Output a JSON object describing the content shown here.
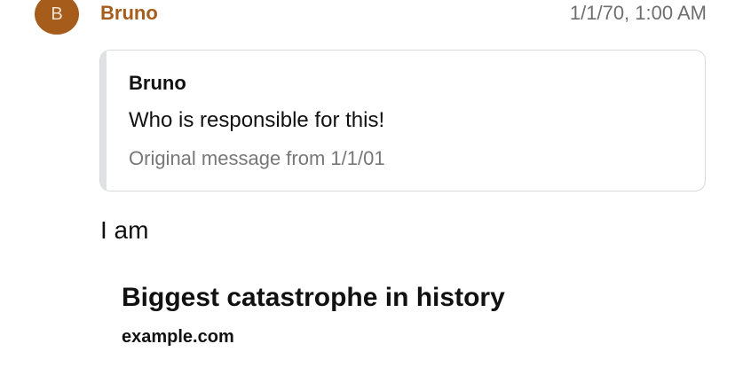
{
  "message": {
    "avatar_initial": "B",
    "sender": "Bruno",
    "timestamp": "1/1/70, 1:00 AM",
    "quoted": {
      "author": "Bruno",
      "text": "Who is responsible for this!",
      "meta": "Original message from 1/1/01"
    },
    "body": "I am",
    "link_preview": {
      "title": "Biggest catastrophe in history",
      "domain": "example.com"
    }
  },
  "colors": {
    "avatar_bg": "#a65c1a",
    "sender_name": "#a65c1a",
    "quote_bar": "#dfe1e4",
    "quote_border": "#dadada",
    "muted_text": "#777777"
  }
}
